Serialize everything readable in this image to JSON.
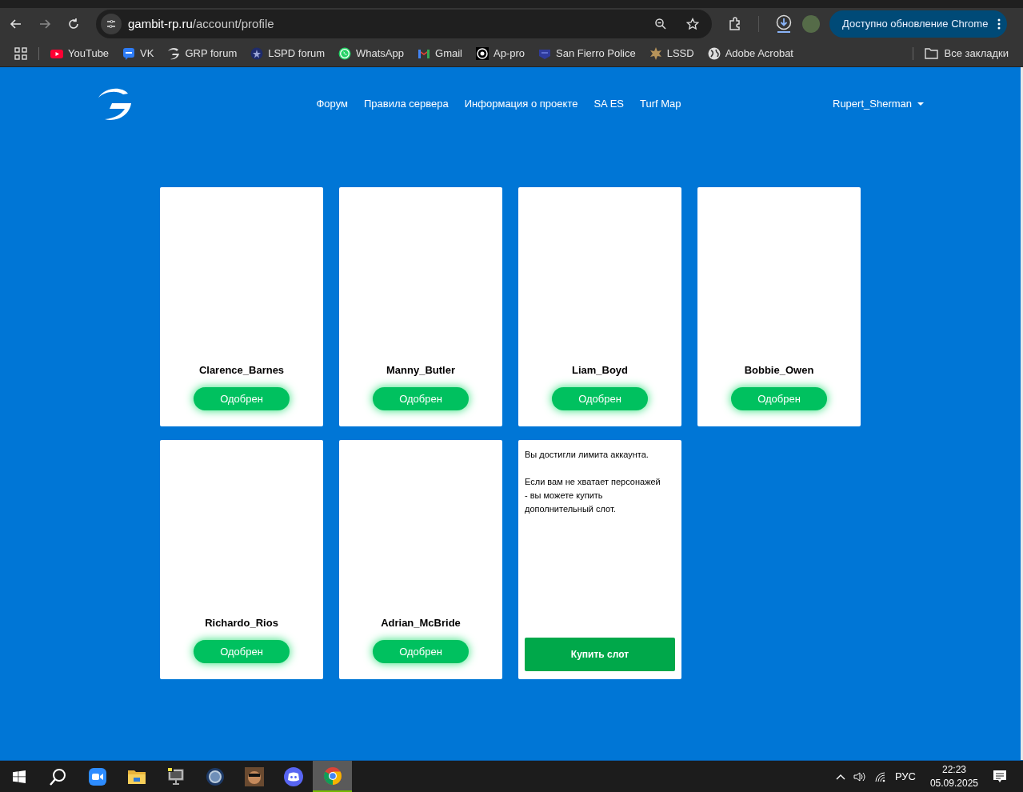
{
  "browser": {
    "url_host": "gambit-rp.ru",
    "url_path": "/account/profile",
    "update_button": "Доступно обновление Chrome"
  },
  "bookmarks": [
    {
      "kind": "youtube",
      "label": "YouTube"
    },
    {
      "kind": "vk",
      "label": "VK"
    },
    {
      "kind": "grp",
      "label": "GRP forum"
    },
    {
      "kind": "lspd",
      "label": "LSPD forum"
    },
    {
      "kind": "whatsapp",
      "label": "WhatsApp"
    },
    {
      "kind": "gmail",
      "label": "Gmail"
    },
    {
      "kind": "appro",
      "label": "Ap-pro"
    },
    {
      "kind": "sfpd",
      "label": "San Fierro Police"
    },
    {
      "kind": "lssd",
      "label": "LSSD"
    },
    {
      "kind": "globe",
      "label": "Adobe Acrobat"
    }
  ],
  "all_bookmarks": "Все закладки",
  "site_nav": [
    "Форум",
    "Правила сервера",
    "Информация о проекте",
    "SA ES",
    "Turf Map"
  ],
  "user": "Rupert_Sherman",
  "characters": [
    {
      "name": "Clarence_Barnes",
      "status": "Одобрен"
    },
    {
      "name": "Manny_Butler",
      "status": "Одобрен"
    },
    {
      "name": "Liam_Boyd",
      "status": "Одобрен"
    },
    {
      "name": "Bobbie_Owen",
      "status": "Одобрен"
    },
    {
      "name": "Richardo_Rios",
      "status": "Одобрен"
    },
    {
      "name": "Adrian_McBride",
      "status": "Одобрен"
    }
  ],
  "limit_card": {
    "paragraphs": [
      "Вы достигли лимита аккаунта.",
      "Если вам не хватает персонажей - вы можете купить дополнительный слот."
    ],
    "button": "Купить слот"
  },
  "taskbar": {
    "apps": [
      {
        "kind": "search",
        "selected": false
      },
      {
        "kind": "zoom",
        "selected": false
      },
      {
        "kind": "folder",
        "selected": false
      },
      {
        "kind": "monitor",
        "selected": false
      },
      {
        "kind": "ring",
        "selected": false
      },
      {
        "kind": "game",
        "selected": false
      },
      {
        "kind": "discord",
        "selected": false
      },
      {
        "kind": "chrome",
        "selected": true
      }
    ],
    "language": "РУС",
    "time": "22:23",
    "date": "05.09.2025"
  }
}
